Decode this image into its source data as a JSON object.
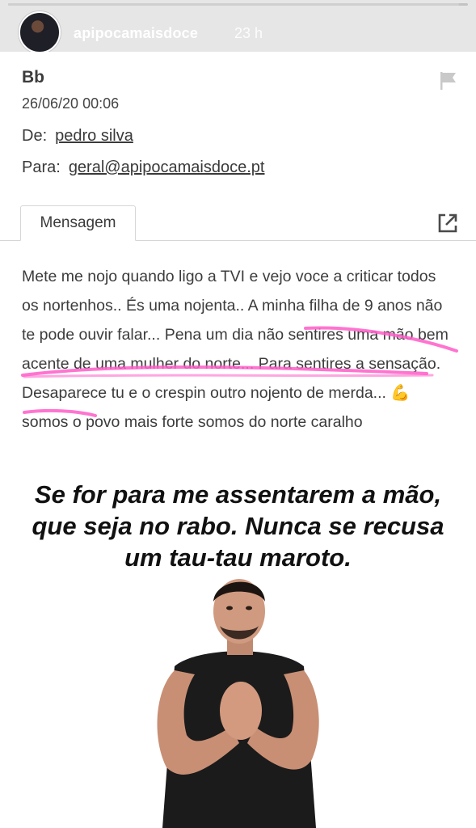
{
  "story": {
    "username": "apipocamaisdoce",
    "time_ago": "23 h",
    "progress": 0.98
  },
  "email": {
    "subject": "Bb",
    "date": "26/06/20 00:06",
    "from_label": "De:",
    "from_value": "pedro silva",
    "to_label": "Para:",
    "to_value": "geral@apipocamaisdoce.pt",
    "tab_label": "Mensagem",
    "body_text": "Mete me nojo quando ligo a TVI e vejo voce a criticar todos os nortenhos.. És uma nojenta.. A minha filha de 9 anos não te pode ouvir falar... Pena um dia não sentires uma mão bem acente de uma mulher do norte... Para sentires a sensação. Desaparece tu e o crespin outro nojento de merda... 💪somos o povo mais forte somos do norte caralho",
    "highlight_color": "#ff5cc8"
  },
  "meme": {
    "caption": "Se for para me assentarem a mão, que seja no rabo. Nunca se recusa um tau-tau maroto."
  },
  "icons": {
    "flag": "flag-icon",
    "external": "open-external-icon",
    "avatar": "avatar-photo"
  }
}
